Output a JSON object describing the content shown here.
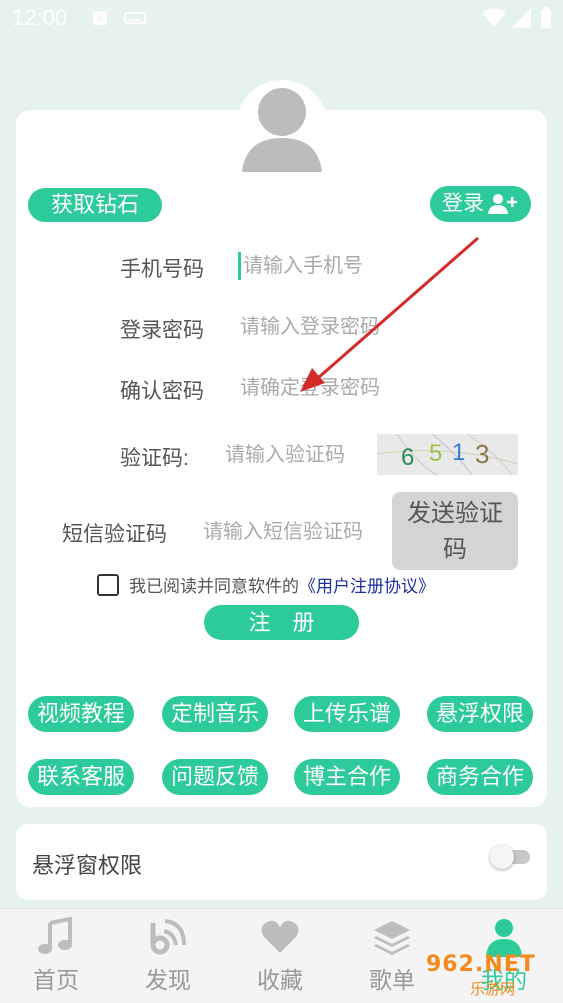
{
  "status_bar": {
    "time": "12:00"
  },
  "header": {
    "get_diamond_label": "获取钻石",
    "login_label": "登录"
  },
  "form": {
    "phone_label": "手机号码",
    "phone_placeholder": "请输入手机号",
    "password_label": "登录密码",
    "password_placeholder": "请输入登录密码",
    "confirm_label": "确认密码",
    "confirm_placeholder": "请确定登录密码",
    "captcha_label": "验证码:",
    "captcha_placeholder": "请输入验证码",
    "captcha_digits": [
      "6",
      "5",
      "1",
      "3"
    ],
    "sms_label": "短信验证码",
    "sms_placeholder": "请输入短信验证码",
    "send_code_line1": "发送验证",
    "send_code_line2": "码",
    "agree_text": "我已阅读并同意软件的",
    "agree_link": "《用户注册协议》",
    "register_label": "注　册"
  },
  "quick_actions": [
    "视频教程",
    "定制音乐",
    "上传乐谱",
    "悬浮权限",
    "联系客服",
    "问题反馈",
    "博主合作",
    "商务合作"
  ],
  "floating_permission": {
    "label": "悬浮窗权限",
    "enabled": false
  },
  "bottom_nav": [
    {
      "label": "首页",
      "icon": "music-note-icon"
    },
    {
      "label": "发现",
      "icon": "discover-icon"
    },
    {
      "label": "收藏",
      "icon": "heart-icon"
    },
    {
      "label": "歌单",
      "icon": "layers-icon"
    },
    {
      "label": "我的",
      "icon": "user-icon",
      "active": true
    }
  ],
  "watermark": {
    "main": "962.NET",
    "sub": "乐游网"
  },
  "colors": {
    "accent": "#2ecb9a",
    "annotation_arrow": "#d42a2a"
  }
}
